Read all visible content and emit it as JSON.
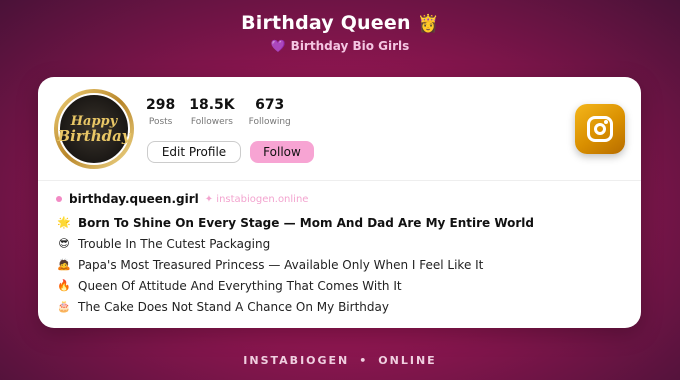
{
  "header": {
    "title": "Birthday Queen",
    "title_emoji": "👸",
    "subtitle_icon": "💜",
    "subtitle": "Birthday Bio Girls"
  },
  "profile": {
    "avatar_text_line1": "Happy",
    "avatar_text_line2": "Birthday",
    "stats": [
      {
        "value": "298",
        "label": "Posts"
      },
      {
        "value": "18.5K",
        "label": "Followers"
      },
      {
        "value": "673",
        "label": "Following"
      }
    ],
    "edit_label": "Edit Profile",
    "follow_label": "Follow",
    "handle": "birthday.queen.girl",
    "site": "✦ instabiogen.online"
  },
  "bio": [
    {
      "icon": "🌟",
      "text": "Born To Shine On Every Stage — Mom And Dad Are My Entire World"
    },
    {
      "icon": "😎",
      "text": "Trouble In The Cutest Packaging"
    },
    {
      "icon": "🙇",
      "text": "Papa's Most Treasured Princess — Available Only When I Feel Like It"
    },
    {
      "icon": "🔥",
      "text": "Queen Of Attitude And Everything That Comes With It"
    },
    {
      "icon": "🎂",
      "text": "The Cake Does Not Stand A Chance On My Birthday"
    }
  ],
  "footer": {
    "left": "INSTABIOGEN",
    "sep": "•",
    "right": "ONLINE"
  },
  "colors": {
    "accent_pink": "#f7a4d3",
    "instagram_gold": "#f4b61b"
  }
}
